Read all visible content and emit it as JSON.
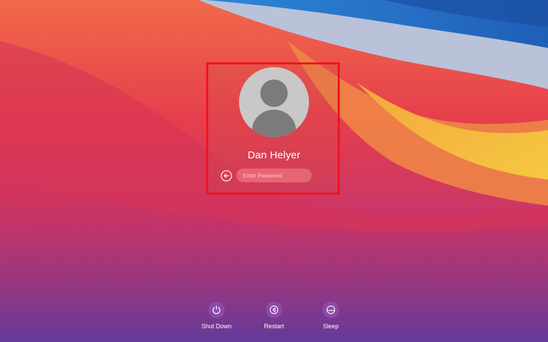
{
  "login": {
    "user_name": "Dan Helyer",
    "password_placeholder": "Enter Password"
  },
  "power_options": [
    {
      "label": "Shut Down",
      "icon": "power-icon"
    },
    {
      "label": "Restart",
      "icon": "restart-icon"
    },
    {
      "label": "Sleep",
      "icon": "sleep-icon"
    }
  ],
  "colors": {
    "highlight_border": "#f0141e",
    "avatar_background": "#c8c8c8",
    "avatar_silhouette": "#7b7b7b",
    "power_button_fill": "#9b5ac0"
  }
}
